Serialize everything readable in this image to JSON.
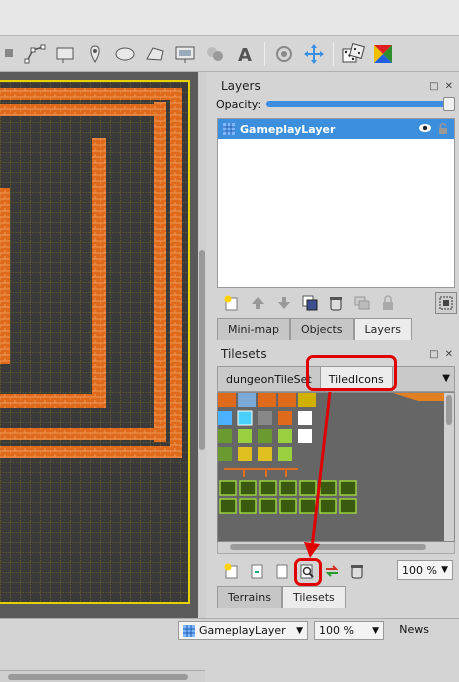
{
  "layers_panel": {
    "title": "Layers",
    "opacity_label": "Opacity:",
    "opacity_value": 1.0,
    "layers": [
      {
        "name": "GameplayLayer",
        "visible": true,
        "selected": true
      }
    ]
  },
  "layer_dock_tabs": [
    {
      "label": "Mini-map",
      "active": false
    },
    {
      "label": "Objects",
      "active": false
    },
    {
      "label": "Layers",
      "active": true
    }
  ],
  "tilesets_panel": {
    "title": "Tilesets",
    "tabs": [
      {
        "label": "dungeonTileSet",
        "active": false
      },
      {
        "label": "TiledIcons",
        "active": true
      }
    ],
    "zoom": "100 %"
  },
  "bottom_dock_tabs": [
    {
      "label": "Terrains",
      "active": false
    },
    {
      "label": "Tilesets",
      "active": true
    }
  ],
  "statusbar": {
    "layer": "GameplayLayer",
    "zoom": "100 %",
    "news": "News"
  },
  "colors": {
    "selection": "#3c8fdc",
    "brick": "#e06a1c",
    "highlight": "#e00000",
    "map_bg": "#3a3a3a",
    "map_border": "#e8d200"
  }
}
